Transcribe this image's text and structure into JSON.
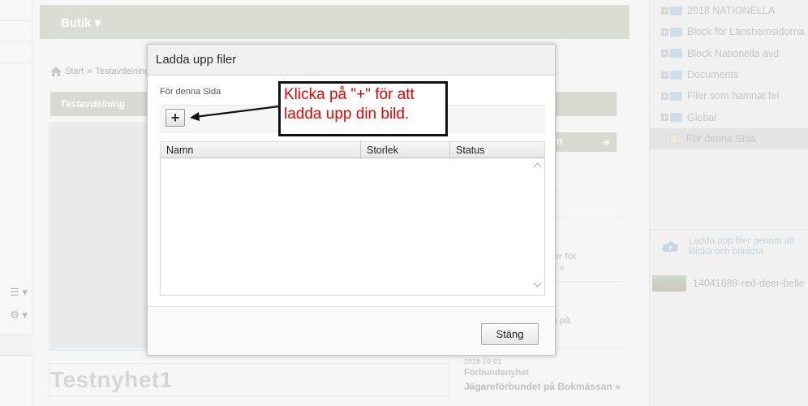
{
  "background": {
    "topbar": {
      "shop_label": "Butik ▾"
    },
    "breadcrumb": {
      "start": "Start",
      "separator": "»",
      "current": "Testavdelning"
    },
    "section": {
      "title": "Testavdelning"
    },
    "headline": "Testnyhet1",
    "news": {
      "new_button_label": "ytt",
      "peek_lines": [
        "r",
        "ger för",
        "e »",
        "g på"
      ],
      "date": "2018-10-01",
      "category": "Förbundsnyhet",
      "link": "Jägareförbundet på Bokmässan »"
    }
  },
  "tree": {
    "items": [
      {
        "label": "2018 NATIONELLA",
        "type": "folder"
      },
      {
        "label": "Block för Länshemsidorna",
        "type": "folder"
      },
      {
        "label": "Block Nationella avd",
        "type": "folder"
      },
      {
        "label": "Documents",
        "type": "folder"
      },
      {
        "label": "Filer som hamnat fel",
        "type": "folder"
      },
      {
        "label": "Global",
        "type": "folder"
      },
      {
        "label": "För denna Sida",
        "type": "page",
        "selected": true
      }
    ],
    "upload_hint": "Ladda upp filer genom att\nklicka och bläddra",
    "file_name": "14041689-red-deer-belle"
  },
  "dialog": {
    "title": "Ladda upp filer",
    "folder_label": "För denna Sida",
    "add_button": "+",
    "columns": [
      "Namn",
      "Storlek",
      "Status"
    ],
    "close_button": "Stäng"
  },
  "annotation": {
    "text": "Klicka på \"+\" för att\nladda upp din bild.",
    "color": "#ee0000"
  }
}
